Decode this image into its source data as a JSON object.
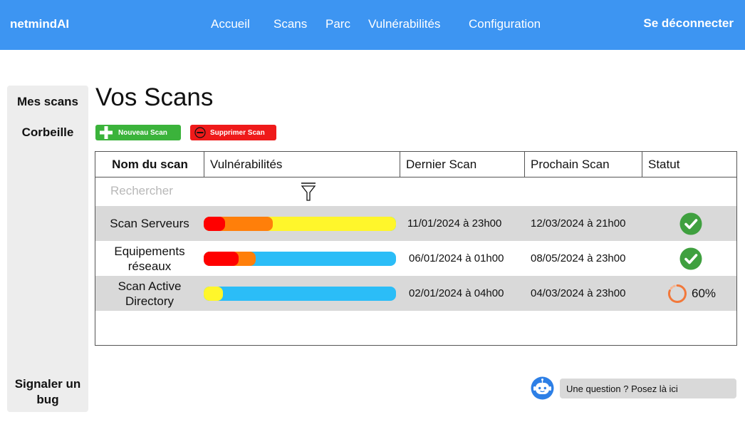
{
  "app": {
    "brand": "netmindAI",
    "nav": [
      "Accueil",
      "Scans",
      "Parc",
      "Vulnérabilités",
      "Configuration"
    ],
    "logout_label": "Se déconnecter"
  },
  "sidebar": {
    "items": [
      "Mes scans",
      "Corbeille"
    ],
    "bottom_item": "Signaler un bug"
  },
  "main": {
    "title": "Vos Scans",
    "new_button": "Nouveau Scan",
    "delete_button": "Supprimer Scan"
  },
  "table": {
    "headers": [
      "Nom du scan",
      "Vulnérabilités",
      "Dernier Scan",
      "Prochain Scan",
      "Statut"
    ],
    "search_placeholder": "Rechercher",
    "rows": [
      {
        "name": "Scan Serveurs",
        "severity": {
          "critical": 0.11,
          "high": 0.25,
          "medium": 0.64,
          "low": 0.0
        },
        "last_scan": "11/01/2024 à 23h00",
        "next_scan": "12/03/2024 à 21h00",
        "status": "done"
      },
      {
        "name": "Equipements réseaux",
        "severity": {
          "critical": 0.18,
          "high": 0.09,
          "medium": 0.0,
          "low": 0.73
        },
        "last_scan": "06/01/2024 à 01h00",
        "next_scan": "08/05/2024 à 23h00",
        "status": "done"
      },
      {
        "name": "Scan Active Directory",
        "severity": {
          "critical": 0.0,
          "high": 0.0,
          "medium": 0.1,
          "low": 0.9
        },
        "last_scan": "02/01/2024 à 04h00",
        "next_scan": "04/03/2024 à 23h00",
        "status": "in-progress",
        "progress": "60%"
      }
    ]
  },
  "help": {
    "text": "Une question ? Posez là ici"
  },
  "colors": {
    "topbar": "#3d95f2",
    "new_button": "#3bb33b",
    "delete_button": "#ef1a1a",
    "severity_critical": "#ff0000",
    "severity_high": "#ff7f0a",
    "severity_medium": "#fff62b",
    "severity_low": "#2bbdf7",
    "status_done": "#3fa03f",
    "status_progress": "#f2783a"
  }
}
